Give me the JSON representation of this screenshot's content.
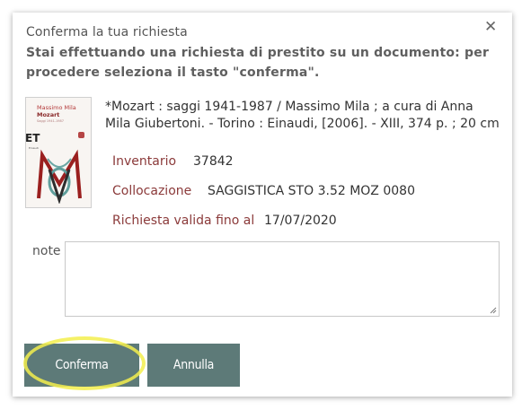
{
  "dialog": {
    "title": "Conferma la tua richiesta",
    "close_symbol": "✕",
    "message": "Stai effettuando una richiesta di prestito su un documento: per procedere seleziona il tasto \"conferma\"."
  },
  "book": {
    "cover": {
      "author": "Massimo Mila",
      "title": "Mozart",
      "subtitle": "Saggi 1941-1987",
      "series_mark": "ET",
      "publisher_mark": "Einaudi"
    },
    "description": "*Mozart : saggi 1941-1987 / Massimo Mila ; a cura di Anna Mila Giubertoni. - Torino : Einaudi, [2006]. - XIII, 374 p. ; 20 cm",
    "inventario_label": "Inventario",
    "inventario_value": "37842",
    "collocazione_label": "Collocazione",
    "collocazione_value": "SAGGISTICA STO 3.52 MOZ 0080",
    "richiesta_label": "Richiesta valida fino al",
    "richiesta_value": "17/07/2020"
  },
  "note": {
    "label": "note",
    "value": ""
  },
  "buttons": {
    "confirm": "Conferma",
    "cancel": "Annulla"
  },
  "colors": {
    "button_bg": "#5d7a78",
    "label_red": "#8b3a3a",
    "highlight": "#f3ef4c"
  }
}
